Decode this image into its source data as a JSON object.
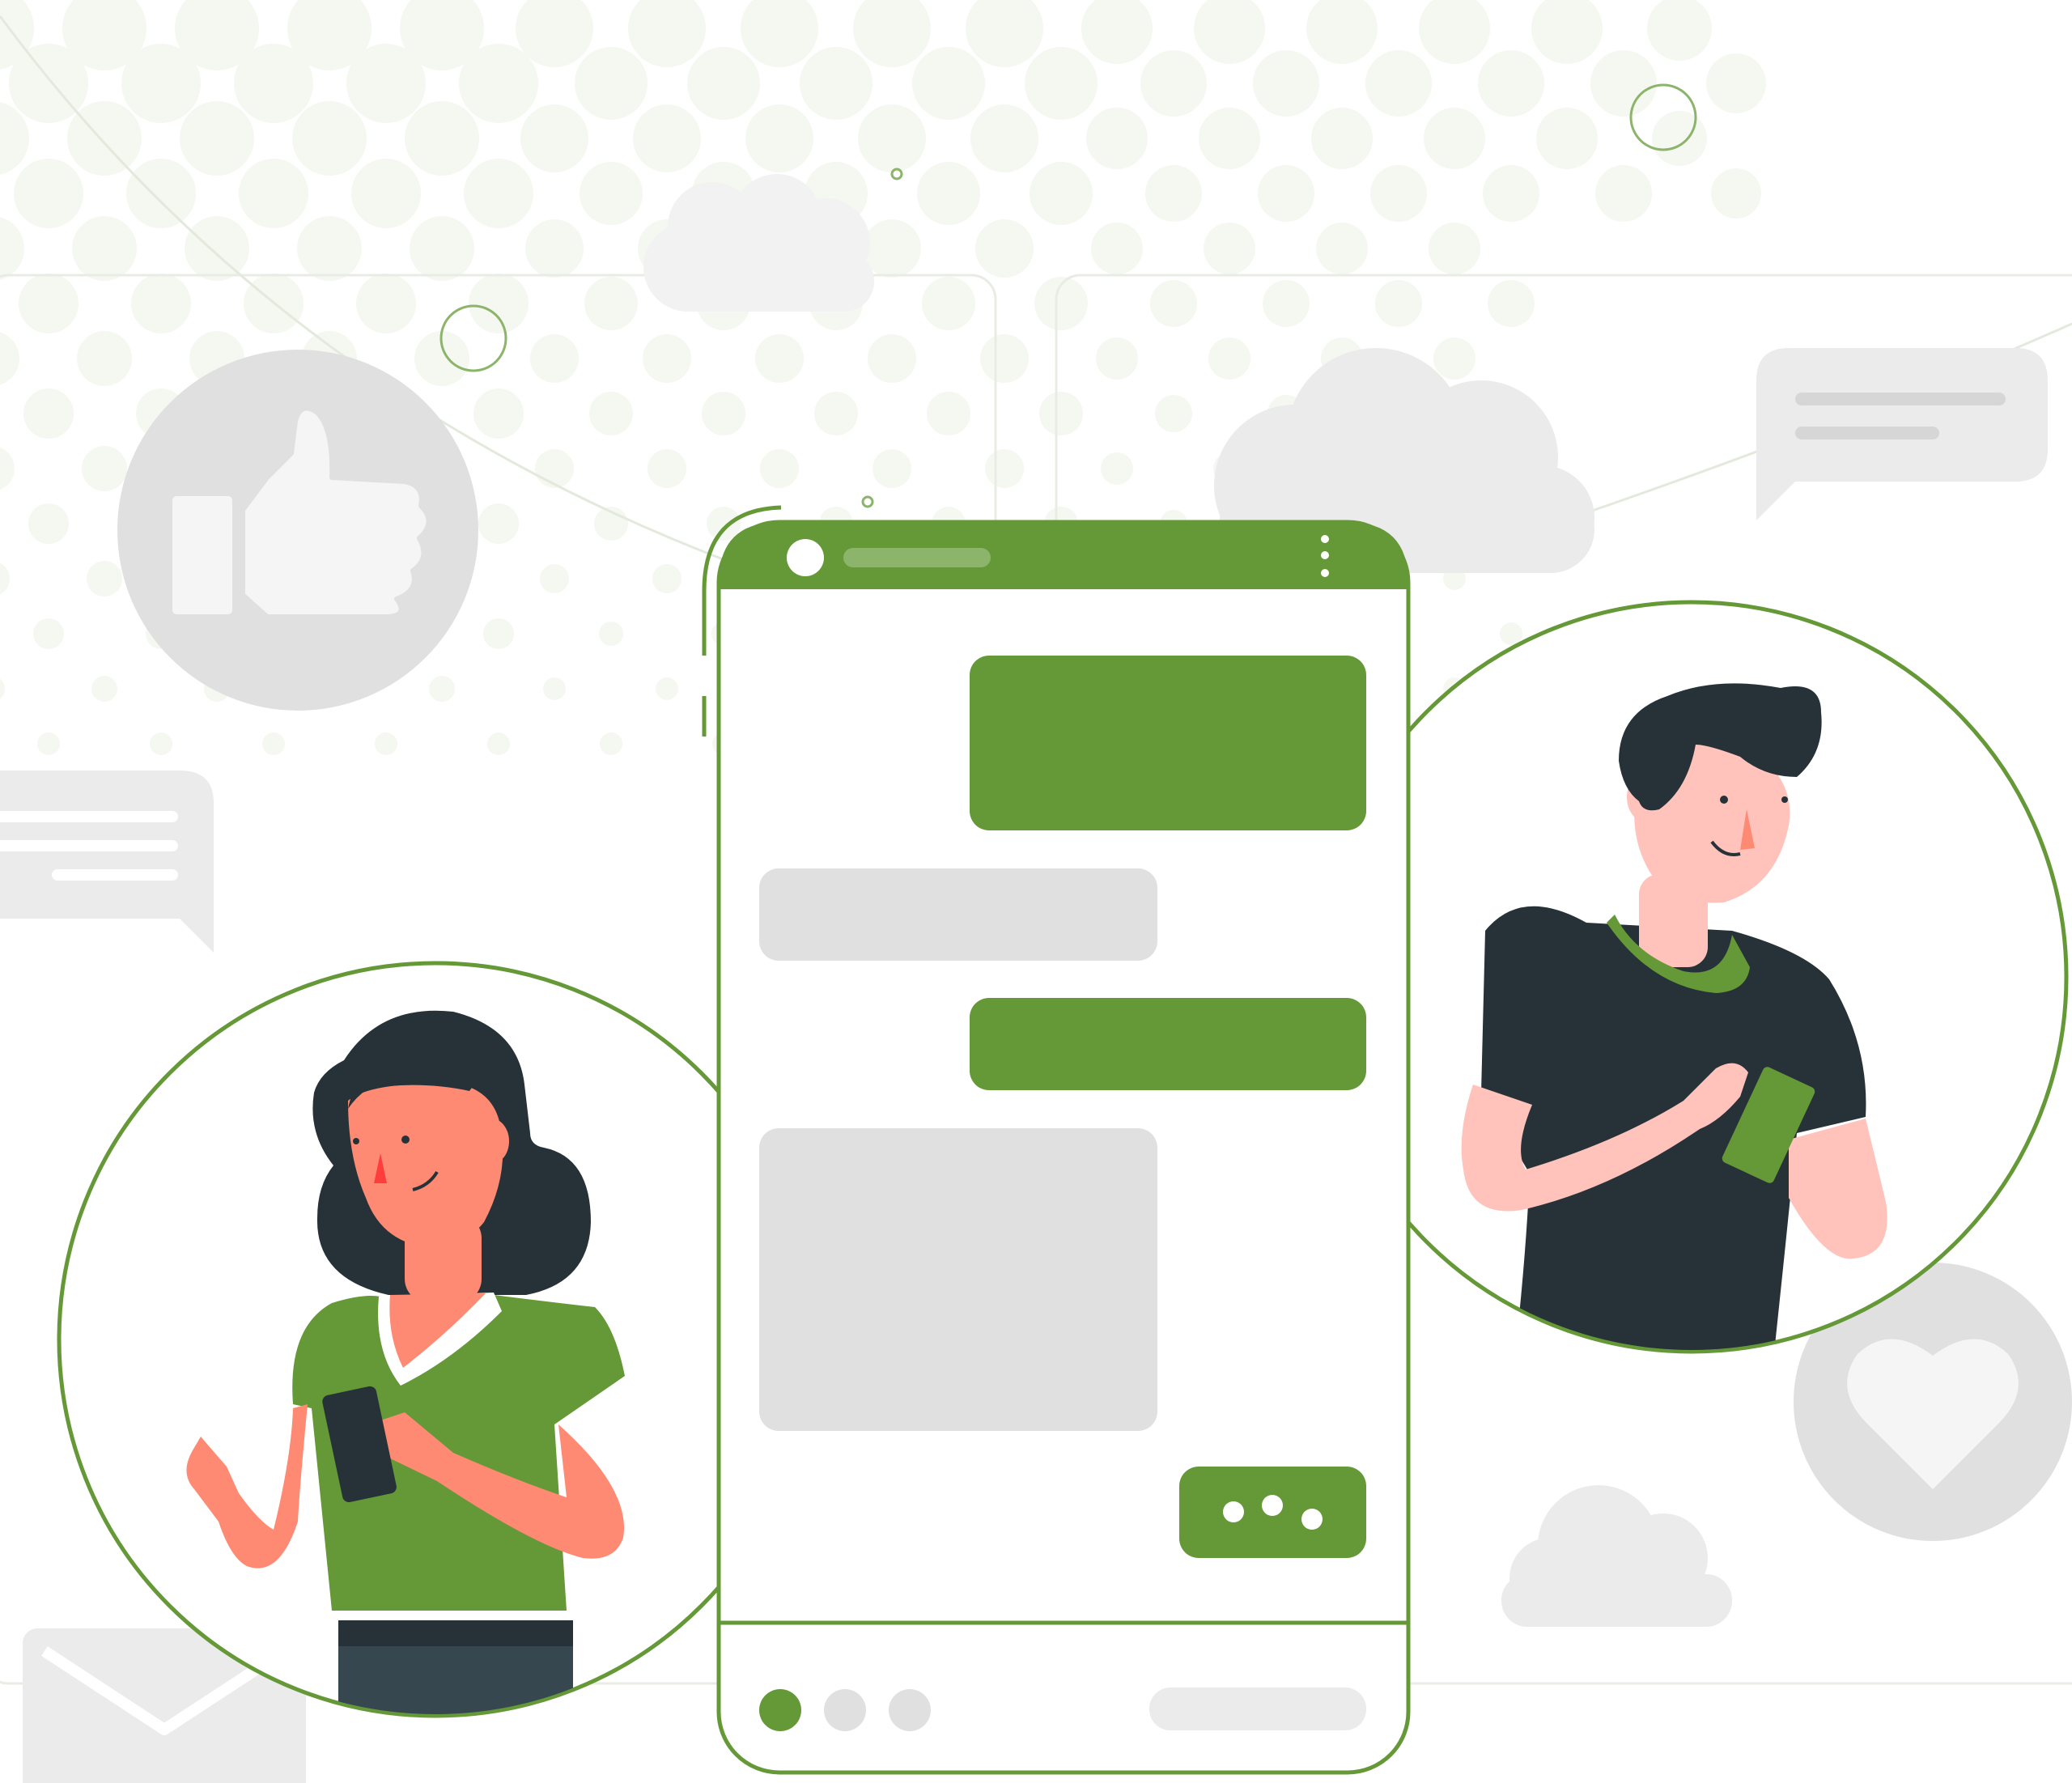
{
  "colors": {
    "accent": "#659937",
    "accent_light": "#8cb46b",
    "bubble_gray": "#e0e0e0",
    "panel_gray": "#ebebeb",
    "dot_tint": "#f5f7f1",
    "hair": "#263238",
    "skin_woman": "#ff8a73",
    "skin_man": "#ffc3bb",
    "shirt_man": "#263238",
    "pants": "#37474f"
  },
  "icons": [
    "thumbs-up-icon",
    "heart-icon",
    "envelope-icon",
    "cloud-icon",
    "speech-bubble-icon",
    "menu-dots-icon",
    "typing-indicator-icon"
  ],
  "chat": {
    "messages": [
      {
        "from": "me"
      },
      {
        "from": "other"
      },
      {
        "from": "me"
      },
      {
        "from": "other"
      },
      {
        "from": "me",
        "typing": true
      }
    ],
    "pager": {
      "count": 3,
      "active": 0
    }
  }
}
